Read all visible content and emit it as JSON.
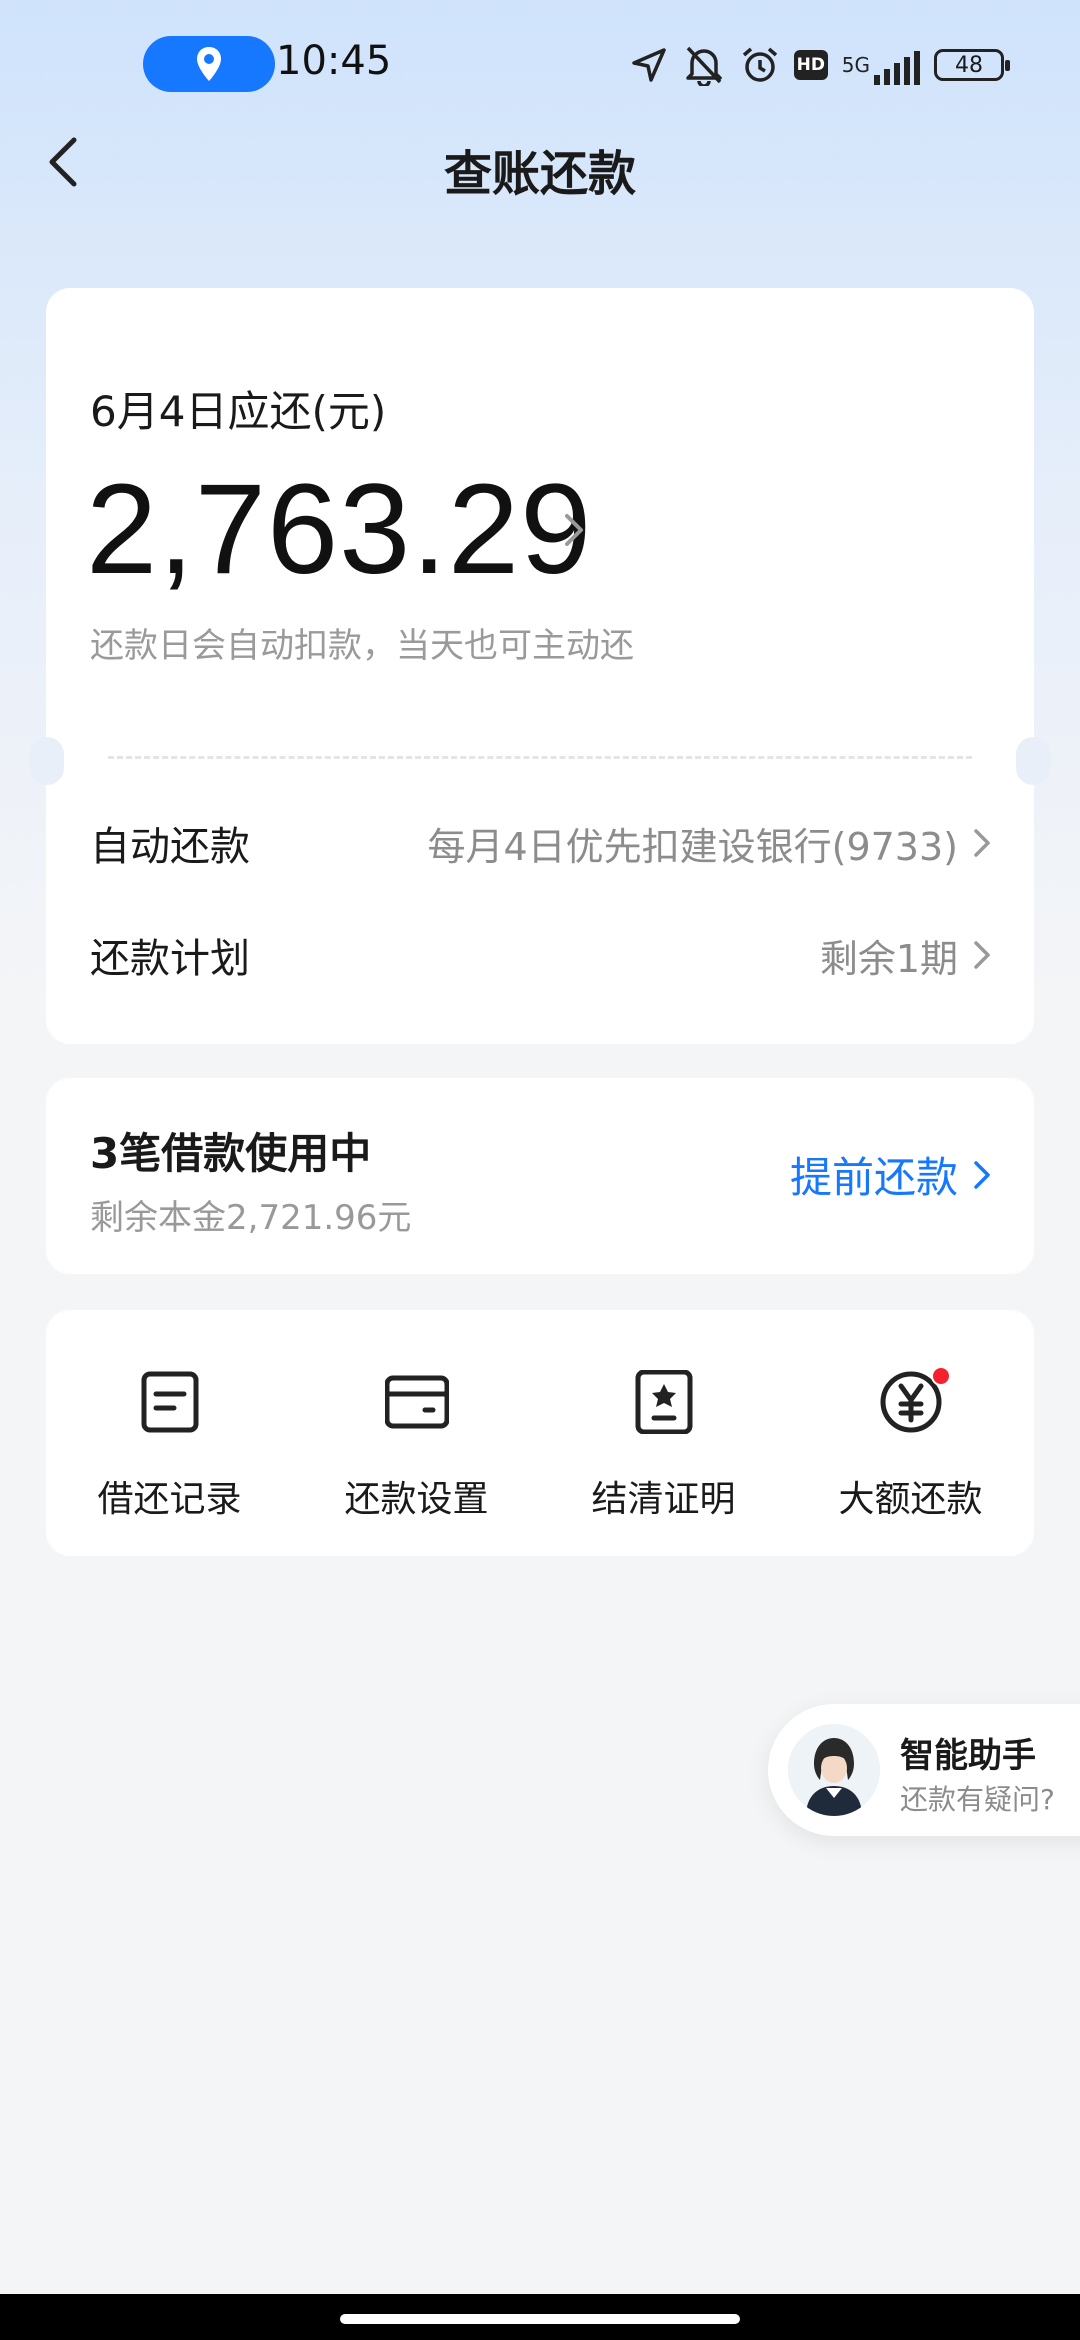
{
  "status_bar": {
    "time": "10:45",
    "network": "5G",
    "hd_label": "HD",
    "battery": "48",
    "icons": [
      "location-pill-icon",
      "navigation-arrow-icon",
      "mute-bell-icon",
      "alarm-icon",
      "hd-icon",
      "signal-icon",
      "battery-icon"
    ]
  },
  "header": {
    "title": "查账还款",
    "back_icon": "back-chevron-icon"
  },
  "bill": {
    "due_label": "6月4日应还(元)",
    "amount": "2,763.29",
    "note": "还款日会自动扣款，当天也可主动还",
    "auto_repay_label": "自动还款",
    "auto_repay_value": "每月4日优先扣建设银行(9733)",
    "plan_label": "还款计划",
    "plan_value": "剩余1期"
  },
  "loans": {
    "title": "3笔借款使用中",
    "remaining": "剩余本金2,721.96元",
    "prepay_label": "提前还款"
  },
  "tools": [
    {
      "label": "借还记录",
      "icon": "record-list-icon"
    },
    {
      "label": "还款设置",
      "icon": "card-icon"
    },
    {
      "label": "结清证明",
      "icon": "certificate-icon"
    },
    {
      "label": "大额还款",
      "icon": "yuan-icon"
    }
  ],
  "assistant": {
    "title": "智能助手",
    "subtitle": "还款有疑问?"
  },
  "colors": {
    "accent": "#1677ff",
    "badge_red": "#f5222d",
    "muted_text": "#8c8c8c"
  }
}
